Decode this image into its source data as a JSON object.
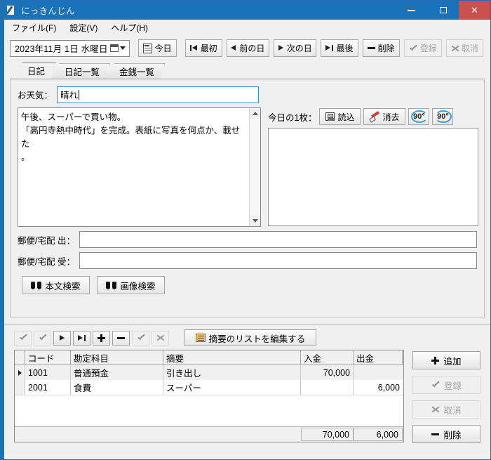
{
  "window": {
    "title": "にっきんじん",
    "icon": "diary-pencil-icon",
    "controls": {
      "minimize": "−",
      "maximize": "□",
      "close": "✕"
    },
    "accent_color": "#1a72b8",
    "close_color": "#c8514f"
  },
  "menu": [
    {
      "label": "ファイル(F)",
      "name": "menu-file"
    },
    {
      "label": "設定(V)",
      "name": "menu-settings"
    },
    {
      "label": "ヘルプ(H)",
      "name": "menu-help"
    }
  ],
  "toolbar": {
    "date_value": "2023年11月 1日 水曜日",
    "buttons": [
      {
        "label": "今日",
        "icon": "calendar-today-icon",
        "disabled": false
      },
      {
        "label": "最初",
        "icon": "first-icon",
        "disabled": false
      },
      {
        "label": "前の日",
        "icon": "prev-icon",
        "disabled": false
      },
      {
        "label": "次の日",
        "icon": "next-icon",
        "disabled": false
      },
      {
        "label": "最後",
        "icon": "last-icon",
        "disabled": false
      },
      {
        "label": "削除",
        "icon": "minus-icon",
        "disabled": false
      },
      {
        "label": "登録",
        "icon": "check-icon",
        "disabled": true
      },
      {
        "label": "取消",
        "icon": "cancel-icon",
        "disabled": true
      }
    ]
  },
  "tabs": [
    {
      "label": "日記",
      "active": true
    },
    {
      "label": "日記一覧",
      "active": false
    },
    {
      "label": "金銭一覧",
      "active": false
    }
  ],
  "diary": {
    "weather_label": "お天気：",
    "weather_value": "晴れ",
    "weather_placeholder": "",
    "body_text": "午後、スーパーで買い物。\n「高円寺熱中時代」を完成。表紙に写真を何点か、載せた\n。",
    "photo_label": "今日の1枚：",
    "photo_buttons": [
      {
        "label": "読込",
        "icon": "load-image-icon"
      },
      {
        "label": "消去",
        "icon": "erase-icon"
      }
    ],
    "rotate_buttons": [
      {
        "label": "90°",
        "icon": "rotate-ccw-icon"
      },
      {
        "label": "90°",
        "icon": "rotate-cw-icon"
      }
    ]
  },
  "post": {
    "out_label": "郵便/宅配 出：",
    "out_value": "",
    "in_label": "郵便/宅配 受：",
    "in_value": ""
  },
  "search": [
    {
      "label": "本文検索",
      "icon": "binoculars-icon"
    },
    {
      "label": "画像検索",
      "icon": "binoculars-icon"
    }
  ],
  "navigator": {
    "buttons": [
      {
        "name": "nav-first",
        "icon": "nav-first-icon",
        "disabled": true
      },
      {
        "name": "nav-prior",
        "icon": "nav-prior-icon",
        "disabled": true
      },
      {
        "name": "nav-next",
        "icon": "nav-next-icon",
        "disabled": false
      },
      {
        "name": "nav-last",
        "icon": "nav-last-icon",
        "disabled": false
      },
      {
        "name": "nav-insert",
        "icon": "plus-icon",
        "disabled": false
      },
      {
        "name": "nav-delete",
        "icon": "minus-icon",
        "disabled": false
      },
      {
        "name": "nav-post",
        "icon": "check-icon",
        "disabled": true
      },
      {
        "name": "nav-cancel",
        "icon": "cancel-icon",
        "disabled": true
      }
    ],
    "edit_list_label": "摘要のリストを編集する",
    "edit_list_icon": "list-edit-icon"
  },
  "grid": {
    "columns": [
      "コード",
      "勘定科目",
      "摘要",
      "入金",
      "出金"
    ],
    "rows": [
      {
        "selected": true,
        "code": "1001",
        "account": "普通預金",
        "summary": "引き出し",
        "in": "70,000",
        "out": ""
      },
      {
        "selected": false,
        "code": "2001",
        "account": "食費",
        "summary": "スーパー",
        "in": "",
        "out": "6,000"
      }
    ],
    "totals": {
      "in": "70,000",
      "out": "6,000"
    }
  },
  "grid_buttons": [
    {
      "label": "追加",
      "icon": "plus-icon",
      "disabled": false
    },
    {
      "label": "登録",
      "icon": "check-icon",
      "disabled": true
    },
    {
      "label": "取消",
      "icon": "cancel-icon",
      "disabled": true
    },
    {
      "label": "削除",
      "icon": "minus-icon",
      "disabled": false
    }
  ]
}
